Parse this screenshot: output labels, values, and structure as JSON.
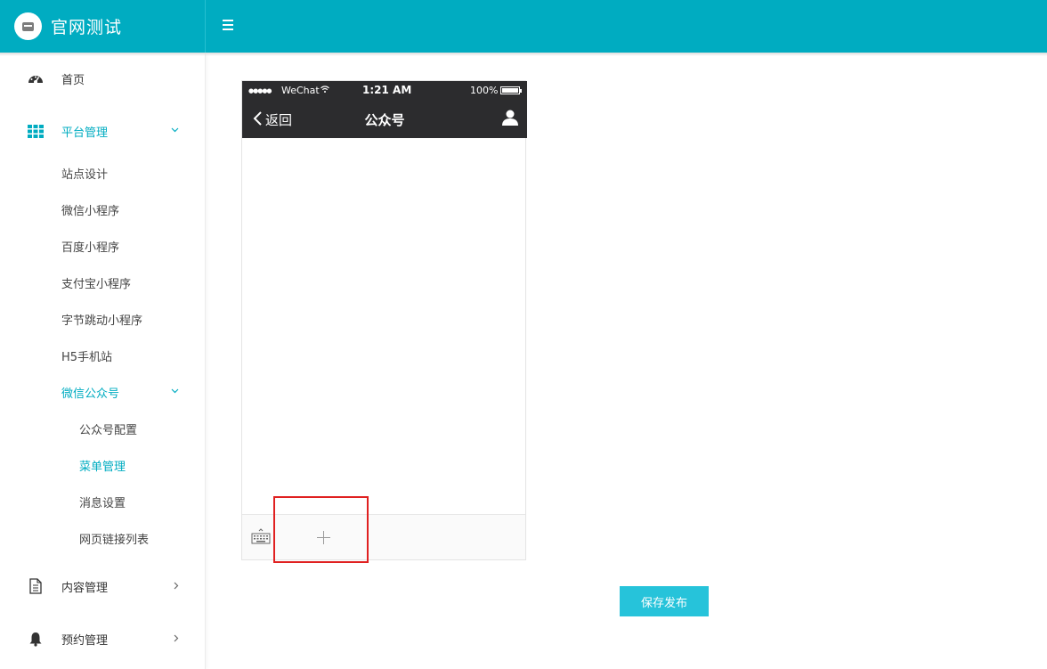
{
  "header": {
    "app_title": "官网测试"
  },
  "sidebar": {
    "home": "首页",
    "platform": {
      "label": "平台管理",
      "children": [
        "站点设计",
        "微信小程序",
        "百度小程序",
        "支付宝小程序",
        "字节跳动小程序",
        "H5手机站"
      ],
      "wechat_official": {
        "label": "微信公众号",
        "children": [
          "公众号配置",
          "菜单管理",
          "消息设置",
          "网页链接列表"
        ]
      }
    },
    "content": "内容管理",
    "booking": "预约管理"
  },
  "phone": {
    "carrier": "WeChat",
    "time": "1:21 AM",
    "battery": "100%",
    "back": "返回",
    "title": "公众号"
  },
  "actions": {
    "save": "保存发布"
  },
  "colors": {
    "brand": "#00acc1",
    "button": "#26c3da",
    "highlight_border": "#e02020"
  }
}
